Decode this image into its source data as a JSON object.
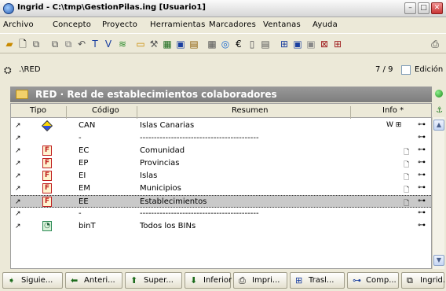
{
  "window": {
    "title": "Ingrid - C:\\tmp\\GestionPilas.ing  [Usuario1]"
  },
  "menu": [
    "Archivo",
    "Concepto",
    "Proyecto",
    "Herramientas",
    "Marcadores",
    "Ventanas",
    "Ayuda"
  ],
  "address": {
    "path": ".\\RED",
    "position": "7 / 9",
    "edit_label": "Edición"
  },
  "panel": {
    "title": "RED · Red de establecimientos colaboradores"
  },
  "columns": {
    "tipo": "Tipo",
    "codigo": "Código",
    "resumen": "Resumen",
    "info": "Info *"
  },
  "rows": [
    {
      "codigo": "CAN",
      "resumen": "Islas Canarias",
      "tipo_icon": "diamond-icon",
      "info": "W ⊞"
    },
    {
      "codigo": "-",
      "resumen": "------------------------------------------",
      "tipo_icon": "",
      "info": ""
    },
    {
      "codigo": "EC",
      "resumen": "Comunidad",
      "tipo_icon": "f-icon",
      "info": "🗋"
    },
    {
      "codigo": "EP",
      "resumen": "Provincias",
      "tipo_icon": "f-icon",
      "info": "🗋"
    },
    {
      "codigo": "EI",
      "resumen": "Islas",
      "tipo_icon": "f-icon",
      "info": "🗋"
    },
    {
      "codigo": "EM",
      "resumen": "Municipios",
      "tipo_icon": "f-icon",
      "info": "🗋"
    },
    {
      "codigo": "EE",
      "resumen": "Establecimientos",
      "tipo_icon": "f-icon",
      "info": "🗋"
    },
    {
      "codigo": "-",
      "resumen": "------------------------------------------",
      "tipo_icon": "",
      "info": ""
    },
    {
      "codigo": "binT",
      "resumen": "Todos los BINs",
      "tipo_icon": "magnifier-icon",
      "info": ""
    }
  ],
  "selected_row": 6,
  "nav_buttons": [
    "Siguie...",
    "Anteri...",
    "Super...",
    "Inferior",
    "Impri...",
    "Trasl...",
    "Comp...",
    "Ingrid..."
  ],
  "colors": {
    "header_band": "#8a8a8a",
    "selected_row": "#c9c9c9",
    "chrome": "#ece9d8"
  }
}
